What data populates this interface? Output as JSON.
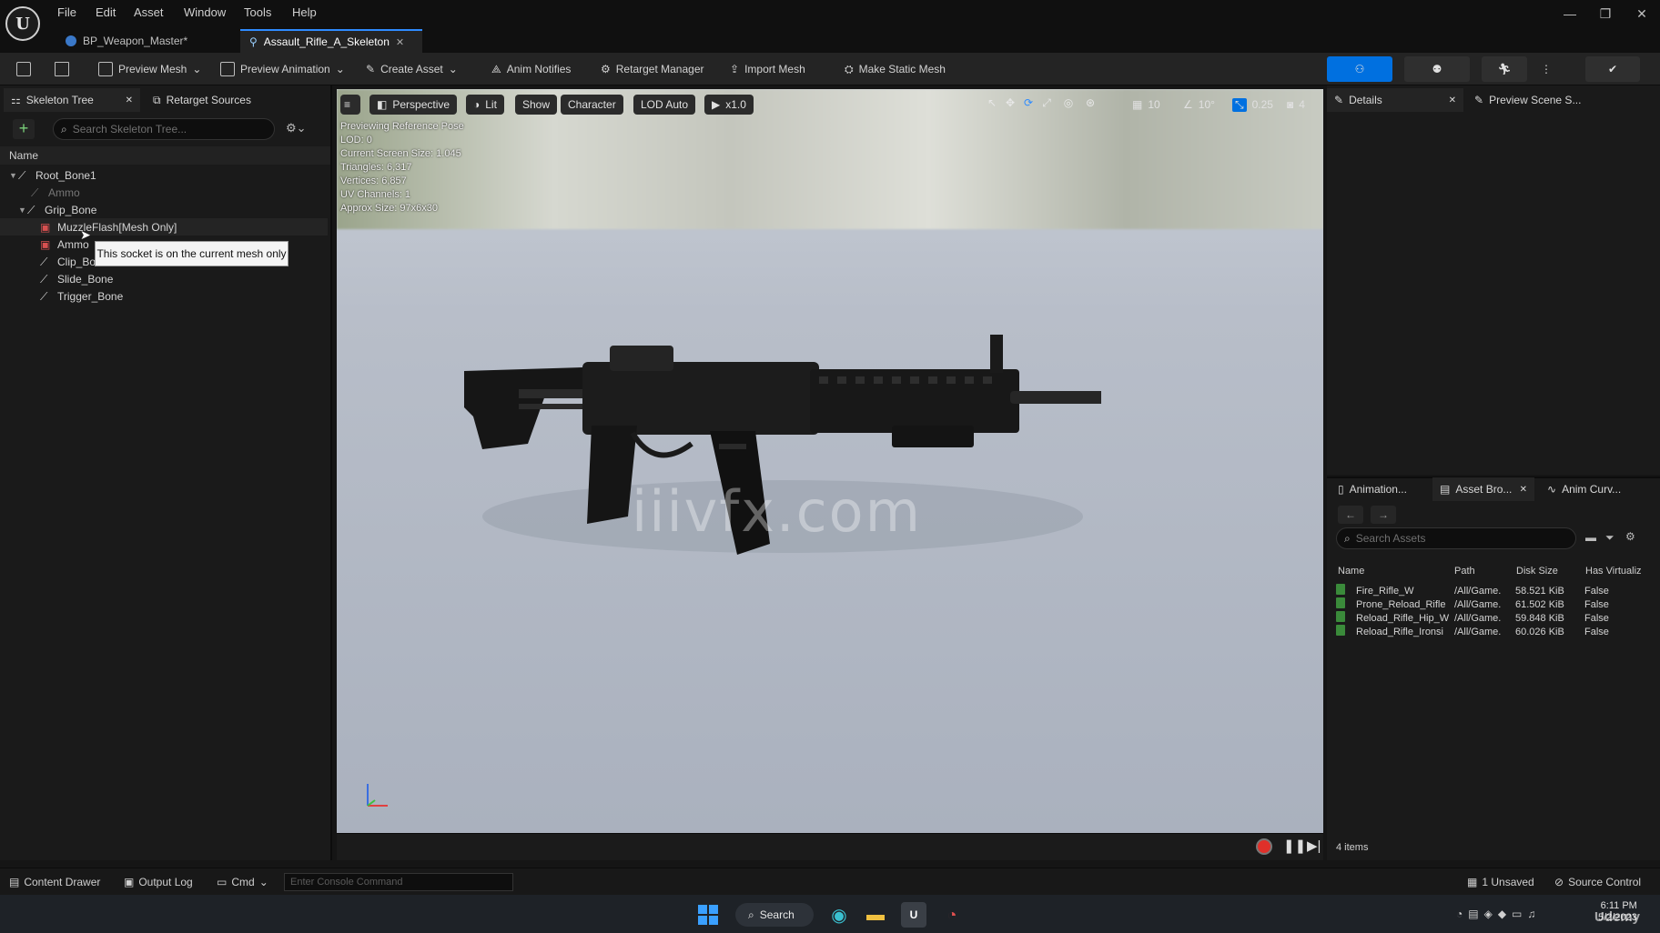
{
  "app": {
    "logo_text": "U"
  },
  "menu": [
    "File",
    "Edit",
    "Asset",
    "Window",
    "Tools",
    "Help"
  ],
  "doc_tabs": [
    {
      "label": "BP_Weapon_Master*"
    },
    {
      "label": "Assault_Rifle_A_Skeleton"
    }
  ],
  "toolbar": {
    "preview_mesh": "Preview Mesh",
    "preview_animation": "Preview Animation",
    "create_asset": "Create Asset",
    "anim_notifies": "Anim Notifies",
    "retarget_manager": "Retarget Manager",
    "import_mesh": "Import Mesh",
    "make_static_mesh": "Make Static Mesh"
  },
  "left_panel": {
    "tabs": [
      "Skeleton Tree",
      "Retarget Sources"
    ],
    "search_placeholder": "Search Skeleton Tree...",
    "column_name": "Name",
    "tree": [
      {
        "label": "Root_Bone1",
        "depth": 0
      },
      {
        "label": "Ammo",
        "depth": 1,
        "dim": true
      },
      {
        "label": "Grip_Bone",
        "depth": 1
      },
      {
        "label": "MuzzleFlash",
        "depth": 2,
        "socket": true,
        "suffix": "[Mesh Only]"
      },
      {
        "label": "Ammo",
        "depth": 2,
        "socket": true
      },
      {
        "label": "Clip_Bo",
        "depth": 2
      },
      {
        "label": "Slide_Bone",
        "depth": 2
      },
      {
        "label": "Trigger_Bone",
        "depth": 2
      }
    ],
    "tooltip": "This socket is on the current mesh only"
  },
  "viewport": {
    "tools": {
      "perspective": "Perspective",
      "lit": "Lit",
      "show": "Show",
      "character": "Character",
      "lod": "LOD Auto",
      "speed": "x1.0"
    },
    "right_tools": {
      "grid": "10",
      "angle": "10°",
      "scale": "0.25",
      "camera": "4"
    },
    "info": [
      "Previewing Reference Pose",
      "LOD: 0",
      "Current Screen Size: 1.045",
      "Triangles: 6,317",
      "Vertices: 6,857",
      "UV Channels: 1",
      "Approx Size: 97x6x30"
    ],
    "watermark": "iiivfx.com"
  },
  "right_top": {
    "tabs": [
      "Details",
      "Preview Scene S..."
    ]
  },
  "right_bottom": {
    "tabs": [
      "Animation...",
      "Asset Bro...",
      "Anim Curv..."
    ],
    "search_placeholder": "Search Assets",
    "columns": [
      "Name",
      "Path",
      "Disk Size",
      "Has Virtualiz"
    ],
    "rows": [
      {
        "name": "Fire_Rifle_W",
        "path": "/All/Game.",
        "size": "58.521 KiB",
        "virt": "False"
      },
      {
        "name": "Prone_Reload_Rifle",
        "path": "/All/Game.",
        "size": "61.502 KiB",
        "virt": "False"
      },
      {
        "name": "Reload_Rifle_Hip_W",
        "path": "/All/Game.",
        "size": "59.848 KiB",
        "virt": "False"
      },
      {
        "name": "Reload_Rifle_Ironsi",
        "path": "/All/Game.",
        "size": "60.026 KiB",
        "virt": "False"
      }
    ],
    "count": "4 items"
  },
  "statusbar": {
    "content_drawer": "Content Drawer",
    "output_log": "Output Log",
    "cmd": "Cmd",
    "console_placeholder": "Enter Console Command",
    "unsaved": "1 Unsaved",
    "source_control": "Source Control"
  },
  "taskbar": {
    "search": "Search",
    "time": "6:11 PM",
    "date": "5/2/2023",
    "brand": "Udemy"
  },
  "colors": {
    "accent": "#0070e0",
    "viewport_floor": "#b6bcc8"
  }
}
